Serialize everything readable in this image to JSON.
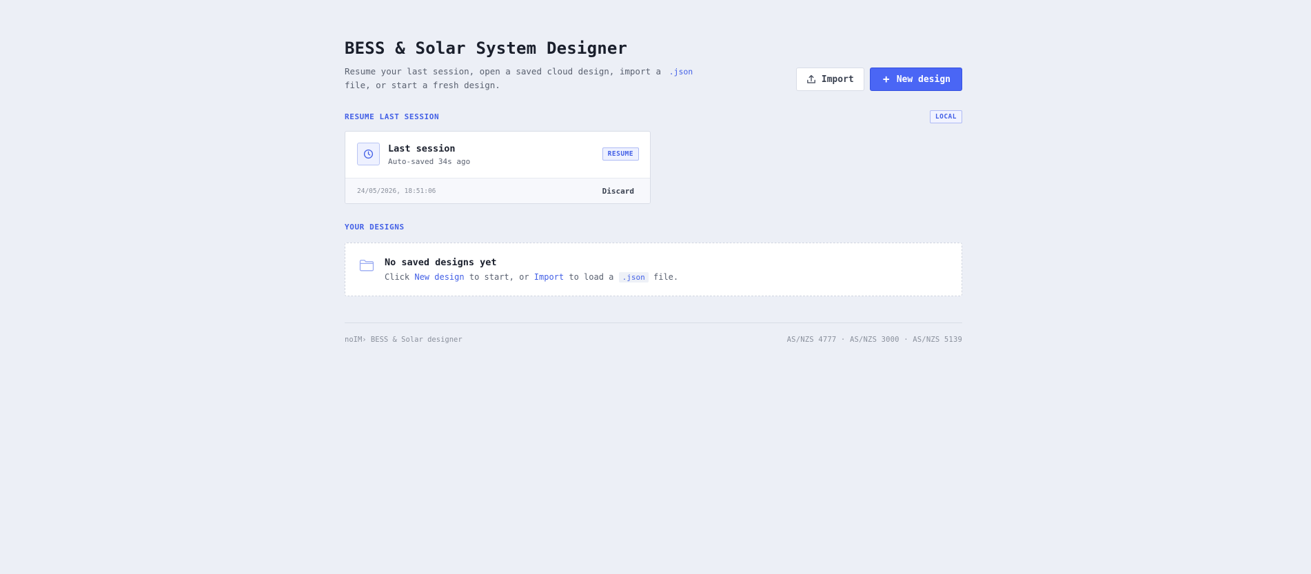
{
  "header": {
    "title": "BESS & Solar System Designer",
    "subtitle_before": "Resume your last session, open a saved cloud design, import a",
    "subtitle_code": ".json",
    "subtitle_after": "file, or start a fresh design.",
    "import_label": "Import",
    "new_design_label": "New design"
  },
  "resume_section": {
    "label": "RESUME LAST SESSION",
    "badge": "LOCAL",
    "card": {
      "icon": "clock-icon",
      "title": "Last session",
      "meta": "Auto-saved 34s ago",
      "resume_label": "RESUME",
      "timestamp": "24/05/2026, 18:51:06",
      "discard_label": "Discard"
    }
  },
  "designs_section": {
    "label": "YOUR DESIGNS",
    "empty": {
      "icon": "folder-icon",
      "title": "No saved designs yet",
      "text_1": "Click",
      "link_new": "New design",
      "text_2": "to start, or",
      "link_import": "Import",
      "text_3": "to load a",
      "code": ".json",
      "text_4": "file."
    }
  },
  "footer": {
    "left": "noIM› BESS & Solar designer",
    "right": "AS/NZS 4777 · AS/NZS 3000 · AS/NZS 5139"
  },
  "colors": {
    "accent": "#4a66f5",
    "background": "#eceff6"
  }
}
